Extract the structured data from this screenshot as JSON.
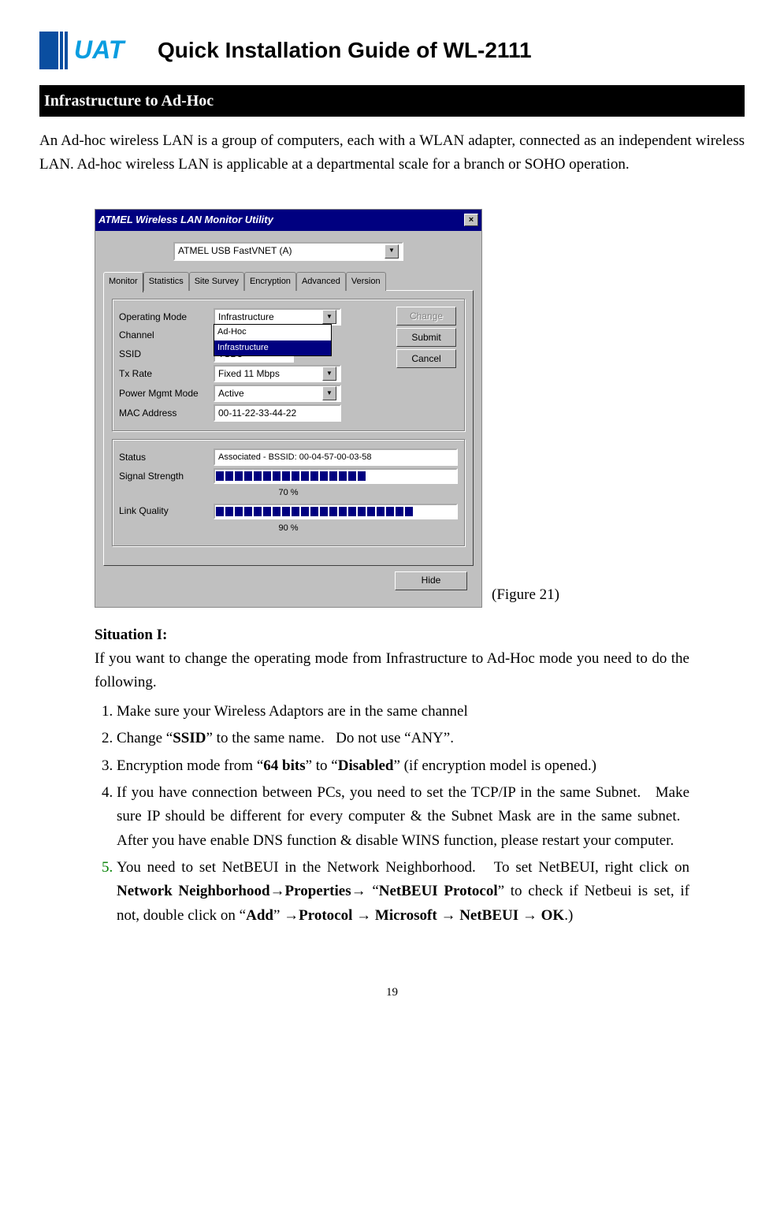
{
  "header": {
    "title": "Quick Installation Guide of WL-2111"
  },
  "section_bar": "Infrastructure to Ad-Hoc",
  "intro": "An Ad-hoc wireless LAN is a group of computers, each with a WLAN adapter, connected as an independent wireless LAN. Ad-hoc wireless LAN is applicable at a departmental scale for a branch or SOHO operation.",
  "figure_label": "(Figure 21)",
  "dialog": {
    "title": "ATMEL Wireless LAN Monitor Utility",
    "close": "×",
    "adapter": "ATMEL USB FastVNET (A)",
    "tabs": [
      "Monitor",
      "Statistics",
      "Site Survey",
      "Encryption",
      "Advanced",
      "Version"
    ],
    "labels": {
      "op_mode": "Operating Mode",
      "channel": "Channel",
      "ssid": "SSID",
      "tx_rate": "Tx Rate",
      "pmm": "Power Mgmt Mode",
      "mac": "MAC Address",
      "status": "Status",
      "signal": "Signal Strength",
      "link": "Link Quality"
    },
    "values": {
      "op_mode": "Infrastructure",
      "dropdown_opts": [
        "Ad-Hoc",
        "Infrastructure"
      ],
      "ssid": "TSD3",
      "tx_rate": "Fixed 11 Mbps",
      "pmm": "Active",
      "mac": "00-11-22-33-44-22",
      "status": "Associated - BSSID: 00-04-57-00-03-58",
      "signal_pct": "70 %",
      "link_pct": "90 %"
    },
    "buttons": {
      "change": "Change",
      "submit": "Submit",
      "cancel": "Cancel",
      "hide": "Hide"
    }
  },
  "situation": {
    "heading": "Situation I:",
    "lead": "If you want to change the operating mode from Infrastructure to Ad-Hoc mode you need to do the following.",
    "steps": {
      "s1": "Make sure your Wireless Adaptors are in the same channel",
      "s2_a": "Change “",
      "s2_b": "SSID",
      "s2_c": "” to the same name.   Do not use “ANY”.",
      "s3_a": "Encryption mode from “",
      "s3_b": "64 bits",
      "s3_c": "” to “",
      "s3_d": "Disabled",
      "s3_e": "” (if encryption model is opened.)",
      "s4": "If you have connection between PCs, you need to set the TCP/IP in the same Subnet.   Make sure IP should be different for every computer & the Subnet Mask are in the same subnet.   After you have enable DNS function & disable WINS function, please restart your computer.",
      "s5_a": "You need to set NetBEUI in the Network Neighborhood.   To set NetBEUI, right click on ",
      "s5_b": "Network Neighborhood",
      "s5_arrow": "→",
      "s5_c": "Properties",
      "s5_d": " “",
      "s5_e": "NetBEUI Protocol",
      "s5_f": "” to check if Netbeui is set, if not, double click on “",
      "s5_g": "Add",
      "s5_h": "” ",
      "s5_i": "Protocol ",
      "s5_j": " Microsoft ",
      "s5_k": " NetBEUI ",
      "s5_l": " OK",
      "s5_m": ".)"
    }
  },
  "page_number": "19"
}
